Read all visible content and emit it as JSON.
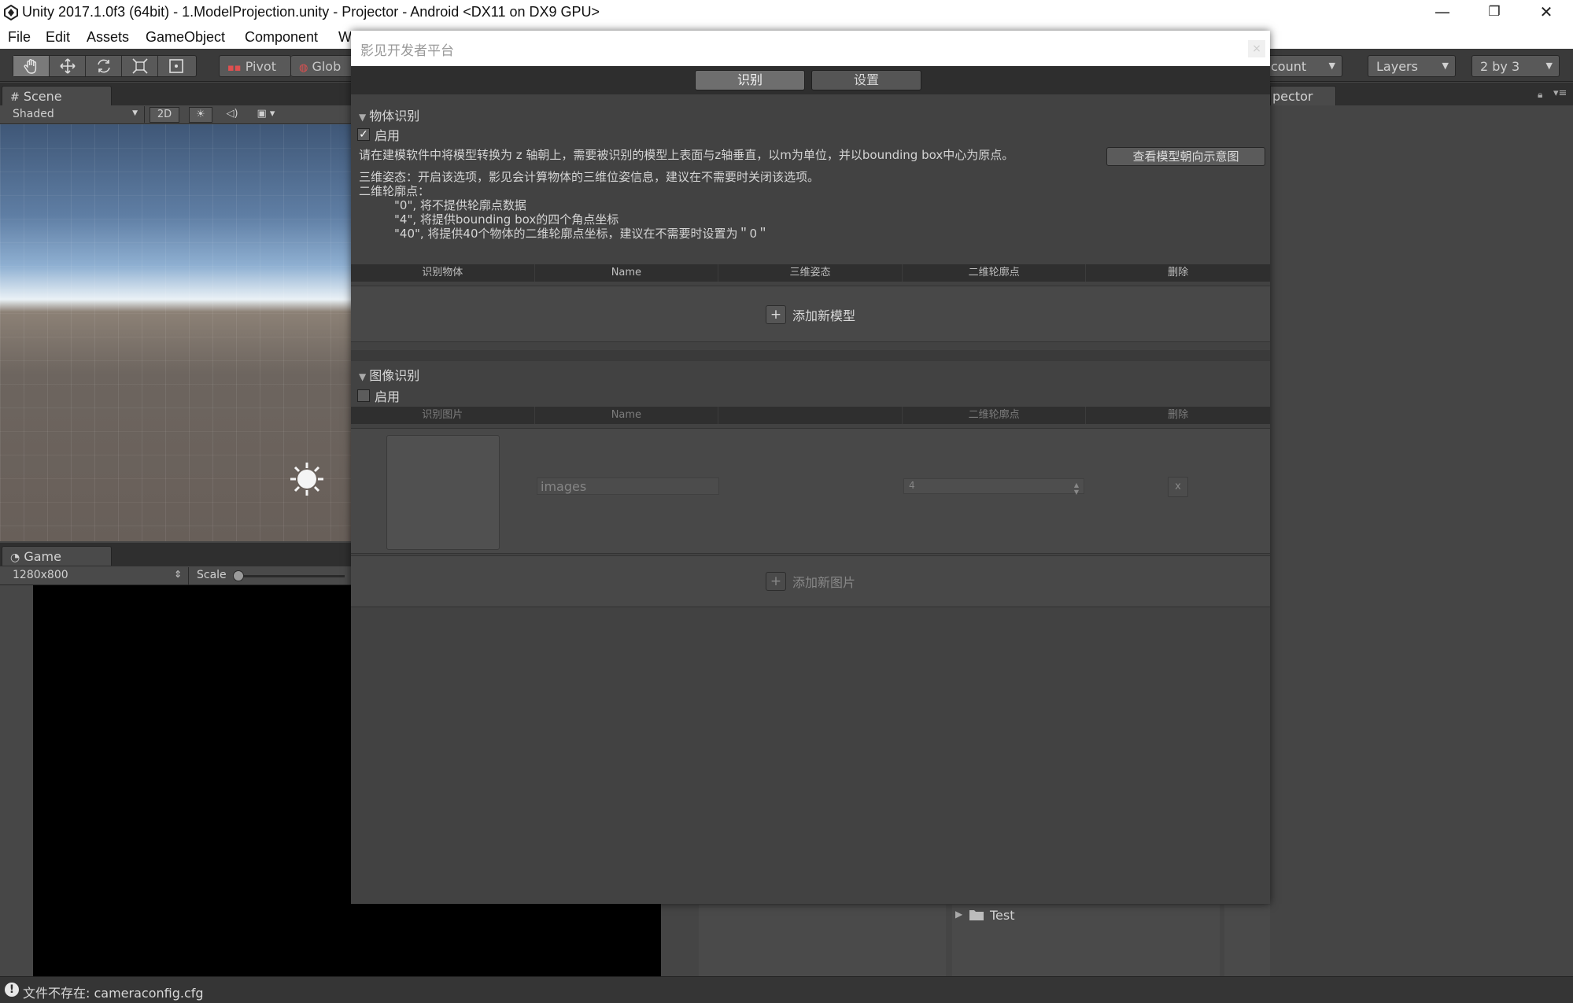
{
  "window": {
    "title": "Unity 2017.1.0f3 (64bit) - 1.ModelProjection.unity - Projector - Android <DX11 on DX9 GPU>",
    "minimize": "—",
    "restore": "❐",
    "close": "✕"
  },
  "menubar": {
    "items": [
      "File",
      "Edit",
      "Assets",
      "GameObject",
      "Component",
      "W"
    ]
  },
  "toolbar": {
    "pivot_label": "Pivot",
    "global_label": "Glob",
    "account_label": "count",
    "layers_label": "Layers",
    "layout_label": "2 by 3"
  },
  "scene": {
    "tab_label": "Scene",
    "shading_mode": "Shaded",
    "mode_2d": "2D"
  },
  "game": {
    "tab_label": "Game",
    "resolution": "1280x800",
    "scale_label": "Scale"
  },
  "inspector": {
    "tab_label": "pector"
  },
  "project": {
    "folder_name": "Test"
  },
  "dialog": {
    "title": "影见开发者平台",
    "close": "×",
    "tabs": [
      "识别",
      "设置"
    ],
    "object_section": {
      "title": "物体识别",
      "enable_label": "启用",
      "enabled": true,
      "instruction": "请在建模软件中将模型转换为 z 轴朝上，需要被识别的模型上表面与z轴垂直，以m为单位，并以bounding box中心为原点。",
      "view_orientation_button": "查看模型朝向示意图",
      "pose_note": "三维姿态：开启该选项，影见会计算物体的三维位姿信息，建议在不需要时关闭该选项。",
      "contour_title": "二维轮廓点：",
      "contour_options": [
        "\"0\", 将不提供轮廓点数据",
        "\"4\", 将提供bounding box的四个角点坐标",
        "\"40\", 将提供40个物体的二维轮廓点坐标，建议在不需要时设置为＂0＂"
      ],
      "columns": [
        "识别物体",
        "Name",
        "三维姿态",
        "二维轮廓点",
        "删除"
      ],
      "add_label": "添加新模型"
    },
    "image_section": {
      "title": "图像识别",
      "enable_label": "启用",
      "enabled": false,
      "columns": [
        "识别图片",
        "Name",
        "",
        "二维轮廓点",
        "删除"
      ],
      "row": {
        "name": "images",
        "contour_value": "4",
        "delete": "x"
      },
      "add_label": "添加新图片"
    }
  },
  "status": {
    "message": "文件不存在:  cameraconfig.cfg"
  }
}
